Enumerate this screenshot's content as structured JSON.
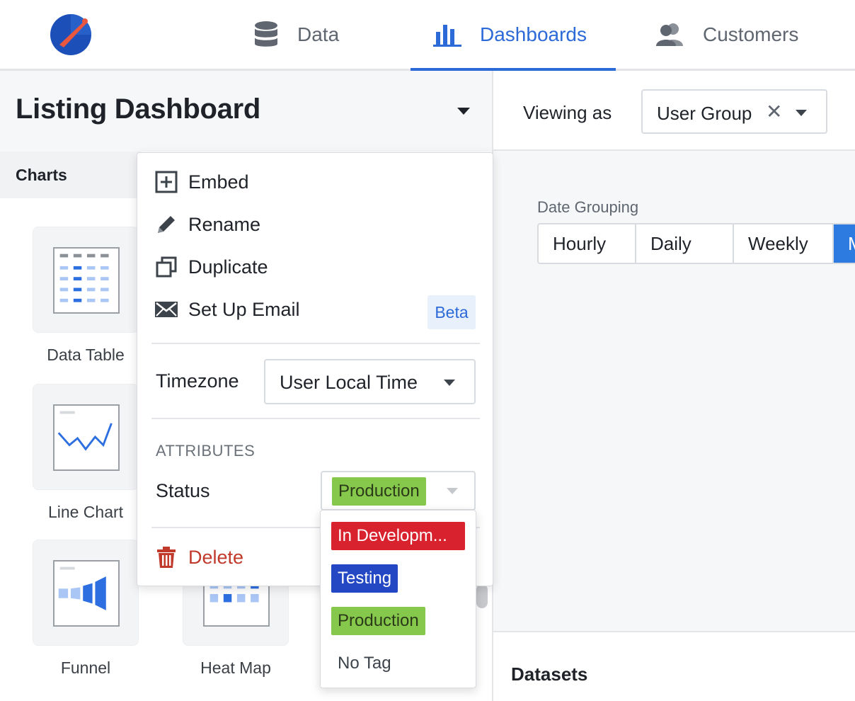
{
  "nav": {
    "tabs": [
      {
        "label": "Data",
        "icon": "database-icon"
      },
      {
        "label": "Dashboards",
        "icon": "bar-chart-icon",
        "active": true
      },
      {
        "label": "Customers",
        "icon": "users-icon"
      }
    ]
  },
  "dashboard": {
    "title": "Listing Dashboard"
  },
  "sidebar": {
    "section_label": "Charts",
    "charts": [
      {
        "label": "Data Table",
        "icon": "data-table-icon"
      },
      {
        "label": "Line Chart",
        "icon": "line-chart-icon"
      },
      {
        "label": "Funnel",
        "icon": "funnel-icon"
      },
      {
        "label": "Heat Map",
        "icon": "heat-map-icon"
      }
    ]
  },
  "viewing": {
    "label": "Viewing as",
    "value": "User Group",
    "clear_glyph": "✕"
  },
  "date_grouping": {
    "label": "Date Grouping",
    "options": [
      "Hourly",
      "Daily",
      "Weekly",
      "M"
    ],
    "active_index": 3
  },
  "datasets": {
    "label": "Datasets"
  },
  "menu": {
    "items": [
      {
        "label": "Embed",
        "icon": "embed-plus-icon"
      },
      {
        "label": "Rename",
        "icon": "pencil-icon"
      },
      {
        "label": "Duplicate",
        "icon": "duplicate-icon"
      },
      {
        "label": "Set Up Email",
        "icon": "envelope-icon"
      }
    ],
    "beta_badge": "Beta",
    "timezone": {
      "label": "Timezone",
      "value": "User Local Time"
    },
    "attributes_heading": "ATTRIBUTES",
    "status": {
      "label": "Status",
      "value": "Production"
    },
    "delete_label": "Delete"
  },
  "status_options": [
    {
      "label": "In Developm...",
      "color": "#d8232f"
    },
    {
      "label": "Testing",
      "color": "#2448c4"
    },
    {
      "label": "Production",
      "color": "#86c84c"
    },
    {
      "label": "No Tag",
      "color": ""
    }
  ],
  "colors": {
    "accent": "#2c6ad8",
    "danger": "#c0392b",
    "production": "#86c84c"
  }
}
